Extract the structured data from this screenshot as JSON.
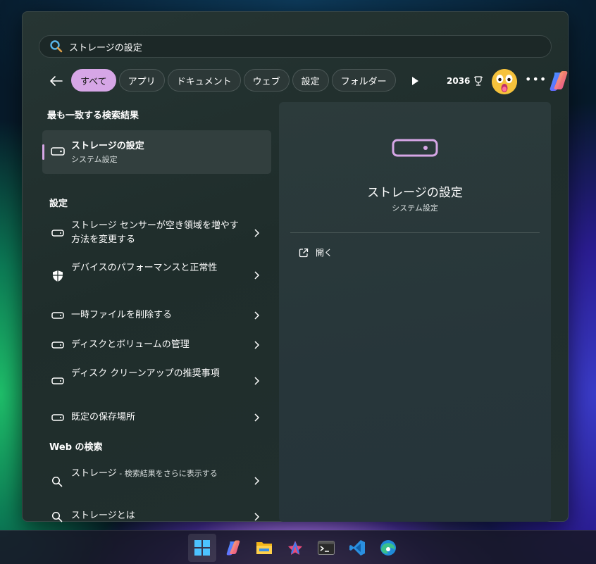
{
  "search": {
    "query": "ストレージの設定"
  },
  "filters": [
    "すべて",
    "アプリ",
    "ドキュメント",
    "ウェブ",
    "設定",
    "フォルダー"
  ],
  "points": "2036",
  "sections": {
    "best": "最も一致する検索結果",
    "settings": "設定",
    "web": "Web の検索"
  },
  "best_match": {
    "title": "ストレージの設定",
    "subtitle": "システム設定"
  },
  "settings_items": [
    {
      "label": "ストレージ センサーが空き領域を増やす方法を変更する"
    },
    {
      "label": "デバイスのパフォーマンスと正常性"
    },
    {
      "label": "一時ファイルを削除する"
    },
    {
      "label": "ディスクとボリュームの管理"
    },
    {
      "label": "ディスク クリーンアップの推奨事項"
    },
    {
      "label": "既定の保存場所"
    }
  ],
  "web_items": [
    {
      "label": "ストレージ",
      "suffix": " - 検索結果をさらに表示する"
    },
    {
      "label": "ストレージとは"
    }
  ],
  "detail": {
    "title": "ストレージの設定",
    "subtitle": "システム設定",
    "open": "開く"
  },
  "colors": {
    "accent": "#d6a6e6",
    "panel": "#263533"
  }
}
